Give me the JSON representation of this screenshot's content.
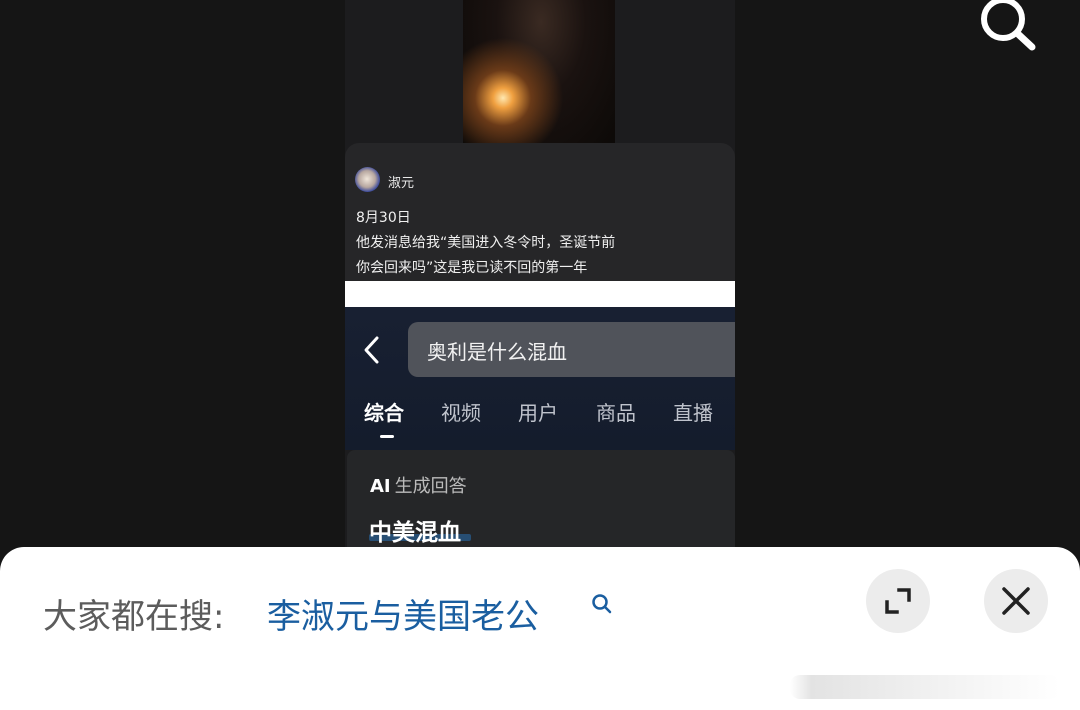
{
  "top_bar": {
    "search_icon": "search-icon"
  },
  "embedded_screenshot": {
    "note_card": {
      "username": "淑元",
      "date": "8月30日",
      "text_line_1": "他发消息给我“美国进入冬令时，圣诞节前",
      "text_line_2": "你会回来吗”这是我已读不回的第一年"
    },
    "search": {
      "back_icon": "chevron-left-icon",
      "query": "奥利是什么混血"
    },
    "tabs": [
      {
        "label": "综合",
        "active": true
      },
      {
        "label": "视频",
        "active": false
      },
      {
        "label": "用户",
        "active": false
      },
      {
        "label": "商品",
        "active": false
      },
      {
        "label": "直播",
        "active": false
      }
    ],
    "ai_card": {
      "ai_prefix": "AI",
      "label": "生成回答",
      "answer": "中美混血"
    }
  },
  "bottom_sheet": {
    "prefix": "大家都在搜:",
    "query": "李淑元与美国老公",
    "query_icon": "search-icon",
    "expand_icon": "expand-icon",
    "close_icon": "close-icon"
  },
  "colors": {
    "page_bg": "#151515",
    "sheet_bg": "#ffffff",
    "query_link": "#1a5ea0",
    "search_area_bg": "#182032"
  }
}
